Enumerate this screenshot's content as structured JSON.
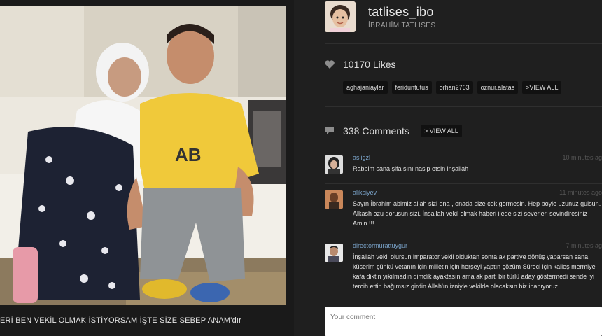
{
  "caption": "ERİ BEN VEKİL OLMAK İSTİYORSAM İŞTE SİZE SEBEP ANAM'dır",
  "profile": {
    "username": "tatlises_ibo",
    "fullname": "İBRAHİM TATLISES"
  },
  "likes": {
    "text": "10170 Likes",
    "tags": [
      "aghajaniaylar",
      "feriduntutus",
      "orhan2763",
      "oznur.alatas",
      ">VIEW ALL"
    ]
  },
  "comments_header": {
    "text": "338 Comments",
    "view_all": "> VIEW ALL"
  },
  "comments": [
    {
      "user": "asligzl",
      "time": "10 minutes ag",
      "text": "Rabbim sana şifa sını nasip etsin inşallah"
    },
    {
      "user": "aliksiyev",
      "time": "11 minutes ago",
      "text": "Sayın İbrahim abimiz allah sizi ona , onada size cok gormesin. Hep boyle uzunuz gulsun. Alkash ozu qorusun sizi. İnsallah vekil olmak haberi ilede sizi severleri sevindiresiniz Amin !!!"
    },
    {
      "user": "directormurattuygur",
      "time": "7 minutes ag",
      "text": "İnşallah vekil olursun imparator vekil olduktan sonra ak partiye dönüş yaparsan sana küserim çünkü vetanın için milletin için herşeyi yaptın çözüm Süreci için kalleş mermiye kafa diktin yıkılmadın dimdik ayaktasın ama ak parti bir türlü aday göstermedi sende iyi tercih ettin bağımsız girdin Allah'ın izniyle vekilde olacaksın biz inanıyoruz"
    }
  ],
  "comment_input": {
    "placeholder": "Your comment"
  },
  "icons": {
    "likes": "heart-icon",
    "comments": "speech-bubble-icon"
  },
  "colors": {
    "background": "#1f1f1f",
    "username_link": "#7aa3c9",
    "tag_bg": "#111111"
  }
}
